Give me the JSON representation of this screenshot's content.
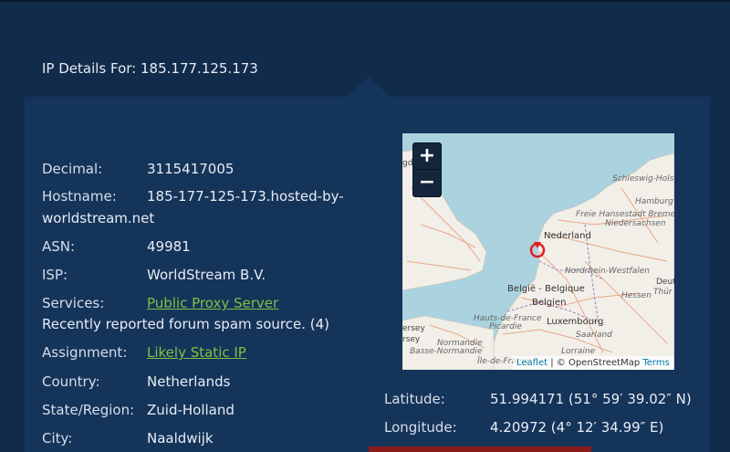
{
  "header": {
    "title": "IP Details For: 185.177.125.173"
  },
  "details": {
    "decimal_label": "Decimal:",
    "decimal": "3115417005",
    "hostname_label": "Hostname:",
    "hostname_line1": "185-177-125-173.hosted-by-",
    "hostname_line2": "worldstream.net",
    "asn_label": "ASN:",
    "asn": "49981",
    "isp_label": "ISP:",
    "isp": "WorldStream B.V.",
    "services_label": "Services:",
    "services_link": "Public Proxy Server",
    "services_note": "Recently reported forum spam source. (4)",
    "assignment_label": "Assignment:",
    "assignment_link": "Likely Static IP",
    "country_label": "Country:",
    "country": "Netherlands",
    "state_label": "State/Region:",
    "state": "Zuid-Holland",
    "city_label": "City:",
    "city": "Naaldwijk"
  },
  "geo": {
    "latitude_label": "Latitude:",
    "latitude": "51.994171  (51° 59′ 39.02″ N)",
    "longitude_label": "Longitude:",
    "longitude": "4.20972  (4° 12′ 34.99″ E)"
  },
  "map": {
    "zoom_in": "+",
    "zoom_out": "−",
    "attribution_leaflet": "Leaflet",
    "attribution_sep": " | © OpenStreetMap ",
    "attribution_terms": "Terms",
    "labels": {
      "nederland": "Nederland",
      "belgie": "België - Belgique",
      "belgien": "Belgien",
      "luxembourg": "Luxembourg",
      "nordrhein": "Nordrhein-Westfalen",
      "hessen": "Hessen",
      "saarland": "Saarland",
      "lorraine": "Lorraine",
      "normandie": "Normandie",
      "basse_normandie": "Basse-Normandie",
      "hauts_de_france": "Hauts-de-France",
      "picardie": "Picardie",
      "ile_de_france": "Île-de-France",
      "schleswig": "Schleswig-Holst",
      "hamburg": "Hamburg",
      "bremen": "Freie Hansestadt Breme",
      "niedersachsen": "Niedersachsen",
      "deutschl": "Deutschl",
      "thur": "Thür",
      "jersey": "ersey",
      "guernsey": "rsey",
      "gd": "gd"
    },
    "colors": {
      "sea": "#aad3df",
      "land": "#f2efe9",
      "road": "#e8a07a",
      "border": "#b08cc0",
      "marker": "#e02020"
    }
  }
}
